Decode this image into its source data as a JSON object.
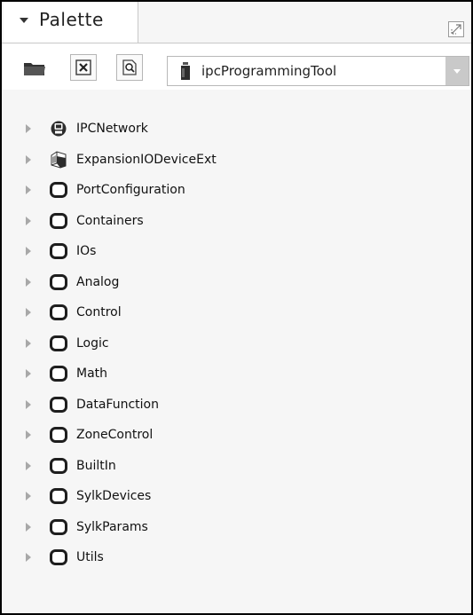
{
  "palette": {
    "tab_title": "Palette",
    "module": "ipcProgrammingTool",
    "toolbar": {
      "icons": [
        "folder-icon",
        "close-icon",
        "find-icon"
      ]
    },
    "items": [
      {
        "label": "IPCNetwork",
        "icon": "network-icon"
      },
      {
        "label": "ExpansionIODeviceExt",
        "icon": "device-ext-icon"
      },
      {
        "label": "PortConfiguration",
        "icon": "folder-icon"
      },
      {
        "label": "Containers",
        "icon": "folder-icon"
      },
      {
        "label": "IOs",
        "icon": "folder-icon"
      },
      {
        "label": "Analog",
        "icon": "folder-icon"
      },
      {
        "label": "Control",
        "icon": "folder-icon"
      },
      {
        "label": "Logic",
        "icon": "folder-icon"
      },
      {
        "label": "Math",
        "icon": "folder-icon"
      },
      {
        "label": "DataFunction",
        "icon": "folder-icon"
      },
      {
        "label": "ZoneControl",
        "icon": "folder-icon"
      },
      {
        "label": "BuiltIn",
        "icon": "folder-icon"
      },
      {
        "label": "SylkDevices",
        "icon": "folder-icon"
      },
      {
        "label": "SylkParams",
        "icon": "folder-icon"
      },
      {
        "label": "Utils",
        "icon": "folder-icon"
      }
    ]
  }
}
